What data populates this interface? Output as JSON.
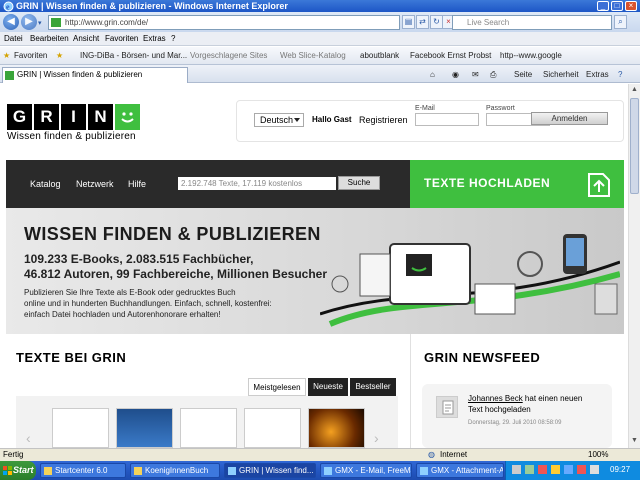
{
  "window": {
    "title": "GRIN | Wissen finden & publizieren - Windows Internet Explorer"
  },
  "address": {
    "url": "http://www.grin.com/de/",
    "search_placeholder": "Live Search"
  },
  "menu": [
    "Datei",
    "Bearbeiten",
    "Ansicht",
    "Favoriten",
    "Extras",
    "?"
  ],
  "favorites": {
    "label": "Favoriten",
    "items": [
      "ING-DiBa - Börsen- und Mar...",
      "Vorgeschlagene Sites",
      "Web Slice-Katalog",
      "aboutblank",
      "Facebook  Ernst Probst",
      "http--www.google"
    ]
  },
  "tab": {
    "title": "GRIN | Wissen finden & publizieren"
  },
  "commandbar": {
    "seite": "Seite",
    "sicherheit": "Sicherheit",
    "extras": "Extras"
  },
  "site": {
    "logo_letters": [
      "G",
      "R",
      "I",
      "N"
    ],
    "tagline": "Wissen finden & publizieren",
    "language": "Deutsch",
    "greeting": "Hallo Gast",
    "register": "Registrieren",
    "email_label": "E-Mail",
    "password_label": "Passwort",
    "login_button": "Anmelden",
    "nav": [
      "Katalog",
      "Netzwerk",
      "Hilfe"
    ],
    "search_placeholder": "2.192.748 Texte, 17.119 kostenlos",
    "search_button": "Suche",
    "upload": "TEXTE HOCHLADEN",
    "hero": {
      "title": "WISSEN FINDEN & PUBLIZIEREN",
      "line1": "109.233 E-Books, 2.083.515 Fachbücher,",
      "line2": "46.812 Autoren, 99 Fachbereiche, Millionen Besucher",
      "desc1": "Publizieren Sie Ihre Texte als E-Book oder gedrucktes Buch",
      "desc2": "online und in hunderten Buchhandlungen. Einfach, schnell, kostenfrei:",
      "desc3": "einfach Datei hochladen und Autorenhonorare erhalten!"
    },
    "texte_title": "TEXTE BEI GRIN",
    "tabs": [
      "Meistgelesen",
      "Neueste",
      "Bestseller"
    ],
    "news_title": "GRIN NEWSFEED",
    "news": {
      "author": "Johannes Beck",
      "text1": " hat einen neuen",
      "text2": "Text hochgeladen",
      "date": "Donnerstag, 29. Juli 2010 08:58:09"
    }
  },
  "statusbar": {
    "left": "Fertig",
    "zone": "Internet",
    "zoom": "100%"
  },
  "taskbar": {
    "start": "Start",
    "tasks": [
      "Startcenter 6.0",
      "KoenigInnenBuch",
      "GRIN | Wissen find...",
      "GMX - E-Mail, FreeMail...",
      "GMX - Attachment-An..."
    ],
    "clock": "09:27"
  },
  "colors": {
    "grin_green": "#3fbf3f",
    "nav_dark": "#2a2a2a",
    "xp_blue": "#245edb"
  }
}
